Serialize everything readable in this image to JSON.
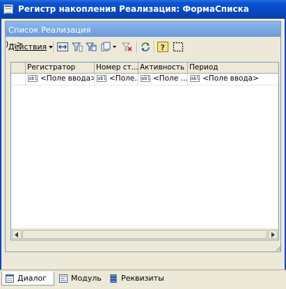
{
  "window": {
    "title": "Регистр накопления Реализация: ФормаСписка",
    "icon": "form-icon"
  },
  "form": {
    "title": "Список Реализация"
  },
  "toolbar": {
    "actions_label": "Действия",
    "buttons": [
      {
        "name": "select-range-button",
        "icon": "arrows-horizontal-icon"
      },
      {
        "name": "filter-button",
        "icon": "filter-icon"
      },
      {
        "name": "filter-by-value-button",
        "icon": "filter-value-icon"
      },
      {
        "name": "copy-dropdown-button",
        "icon": "copy-icon"
      },
      {
        "name": "clear-filter-button",
        "icon": "clear-filter-icon"
      },
      {
        "name": "refresh-button",
        "icon": "refresh-icon"
      },
      {
        "name": "help-button",
        "icon": "help-icon"
      },
      {
        "name": "selection-frame-button",
        "icon": "selection-frame-icon"
      }
    ]
  },
  "grid": {
    "columns": [
      "",
      "Регистратор",
      "Номер ст...",
      "Активность",
      "Период"
    ],
    "rows": [
      {
        "cells": [
          "",
          "<Поле ввода>",
          "<Поле...",
          "<Поле ...",
          "<Поле ввода>"
        ]
      }
    ],
    "field_icon_text": "abl"
  },
  "tabs": [
    {
      "label": "Диалог",
      "icon": "dialog-icon",
      "active": true
    },
    {
      "label": "Модуль",
      "icon": "module-icon",
      "active": false
    },
    {
      "label": "Реквизиты",
      "icon": "attributes-icon",
      "active": false
    }
  ],
  "colors": {
    "titlebar": "#0a55d6",
    "form_header": "#7aa7e4",
    "window_bg": "#ece9d8"
  }
}
